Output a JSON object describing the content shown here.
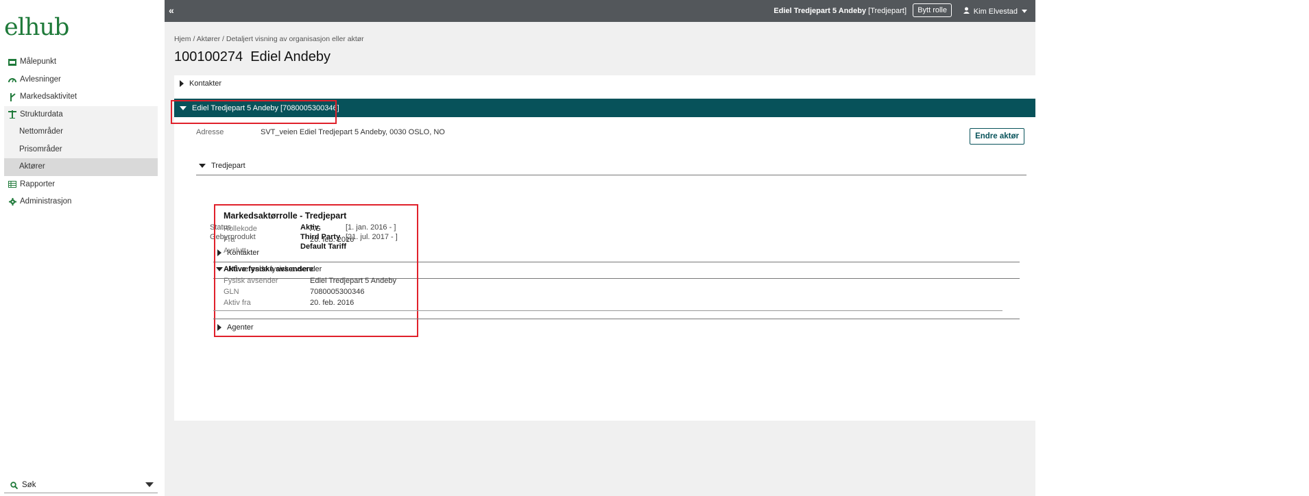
{
  "sidebar": {
    "logo": "elhub",
    "items": [
      {
        "label": "Målepunkt"
      },
      {
        "label": "Avlesninger"
      },
      {
        "label": "Markedsaktivitet"
      },
      {
        "label": "Strukturdata"
      },
      {
        "label": "Nettområder"
      },
      {
        "label": "Prisområder"
      },
      {
        "label": "Aktører"
      },
      {
        "label": "Rapporter"
      },
      {
        "label": "Administrasjon"
      }
    ],
    "search_label": "Søk"
  },
  "topbar": {
    "collapse": "«",
    "actor_name": "Ediel Tredjepart 5 Andeby",
    "actor_role": "[Tredjepart]",
    "switch_role": "Bytt rolle",
    "user": "Kim Elvestad"
  },
  "breadcrumb": {
    "home": "Hjem",
    "actors": "Aktører",
    "current": "Detaljert visning av organisasjon eller aktør",
    "sep": "/"
  },
  "page_title": "100100274  Ediel Andeby",
  "panel": {
    "kontakter_top": "Kontakter",
    "actor_bar": "Ediel Tredjepart 5 Andeby [7080005300346]",
    "address_label": "Adresse",
    "address_value": "SVT_veien Ediel Tredjepart 5 Andeby, 0030 OSLO, NO",
    "edit_button": "Endre aktør",
    "tredjepart_header": "Tredjepart",
    "status_label": "Status",
    "status_value": "Aktiv",
    "status_date": "[1. jan. 2016 - ]",
    "gebyr_label": "Gebyrprodukt",
    "gebyr_value_1": "Third Party",
    "gebyr_value_2": "Default Tariff",
    "gebyr_date": "[21. jul. 2017 - ]",
    "kontakter_sub": "Kontakter",
    "naavaerende": "Nåværende fysisk avsender",
    "agenter": "Agenter"
  },
  "role_card": {
    "title": "Markedsaktørrolle - Tredjepart",
    "rollekode_label": "Rollekode",
    "rollekode_value": "AG",
    "fra_label": "Fra",
    "fra_value": "20. feb. 2016",
    "avslutt_label": "Avslutt",
    "section_title": "Aktive fysiske avsendere",
    "fysisk_label": "Fysisk avsender",
    "fysisk_value": "Ediel Tredjepart 5 Andeby",
    "gln_label": "GLN",
    "gln_value": "7080005300346",
    "aktiv_label": "Aktiv fra",
    "aktiv_value": "20. feb. 2016"
  },
  "colors": {
    "topbar": "#53575b",
    "actor_bar": "#07525a",
    "highlight": "#e0202a",
    "logo": "#1f7a3a"
  }
}
